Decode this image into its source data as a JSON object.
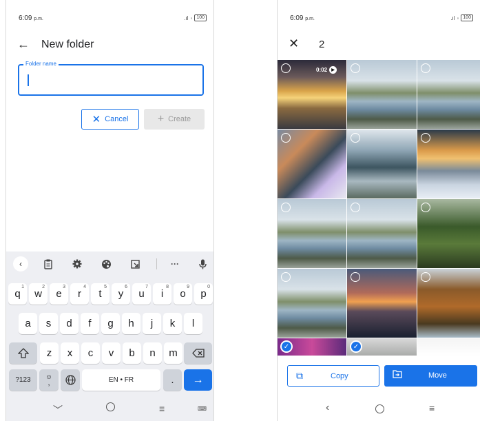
{
  "left_screen": {
    "status": {
      "time": "6:09",
      "time_suffix": "p.m.",
      "battery": "100"
    },
    "title": "New folder",
    "field_label": "Folder name",
    "field_value": "",
    "cancel_label": "Cancel",
    "create_label": "Create",
    "keyboard": {
      "toolbar": [
        "back-chevron-icon",
        "clipboard-icon",
        "settings-icon",
        "palette-icon",
        "resize-icon",
        "more-icon",
        "mic-icon"
      ],
      "more_label": "···",
      "row1": [
        {
          "key": "q",
          "hint": "1"
        },
        {
          "key": "w",
          "hint": "2"
        },
        {
          "key": "e",
          "hint": "3"
        },
        {
          "key": "r",
          "hint": "4"
        },
        {
          "key": "t",
          "hint": "5"
        },
        {
          "key": "y",
          "hint": "6"
        },
        {
          "key": "u",
          "hint": "7"
        },
        {
          "key": "i",
          "hint": "8"
        },
        {
          "key": "o",
          "hint": "9"
        },
        {
          "key": "p",
          "hint": "0"
        }
      ],
      "row2": [
        "a",
        "s",
        "d",
        "f",
        "g",
        "h",
        "j",
        "k",
        "l"
      ],
      "row3": [
        "z",
        "x",
        "c",
        "v",
        "b",
        "n",
        "m"
      ],
      "symbols_label": "?123",
      "emoji_comma": ",",
      "space_label": "EN • FR",
      "period_label": "."
    },
    "nav": [
      "chevron-down-icon",
      "home-circle-icon",
      "menu-icon",
      "keyboard-icon"
    ]
  },
  "right_screen": {
    "status": {
      "time": "6:09",
      "time_suffix": "p.m.",
      "battery": "100"
    },
    "selected_count": "2",
    "video_duration": "0:02",
    "tiles": [
      {
        "theme": "sunset-lake",
        "selected": false,
        "video": true
      },
      {
        "theme": "lake-rocks",
        "selected": false,
        "video": false
      },
      {
        "theme": "lake-rocks",
        "selected": false,
        "video": false
      },
      {
        "theme": "collage",
        "selected": false,
        "video": false
      },
      {
        "theme": "waterfall-lake",
        "selected": false,
        "video": false
      },
      {
        "theme": "winter-sunset",
        "selected": false,
        "video": false
      },
      {
        "theme": "lake-rocks",
        "selected": false,
        "video": false
      },
      {
        "theme": "lake-rocks",
        "selected": false,
        "video": false
      },
      {
        "theme": "green-valley",
        "selected": false,
        "video": false
      },
      {
        "theme": "lake-rocks",
        "selected": false,
        "video": false
      },
      {
        "theme": "sunset-sea",
        "selected": false,
        "video": false
      },
      {
        "theme": "autumn-forest",
        "selected": false,
        "video": false
      },
      {
        "theme": "purple-collage",
        "selected": true,
        "video": false
      },
      {
        "theme": "gray-strip",
        "selected": true,
        "video": false
      },
      {
        "theme": "blank",
        "selected": false,
        "video": false
      }
    ],
    "copy_label": "Copy",
    "move_label": "Move",
    "nav": [
      "back-icon",
      "home-icon",
      "recents-icon"
    ]
  },
  "colors": {
    "accent": "#1a73e8",
    "keyboard_bg": "#eeeff3",
    "disabled": "#e8e8e8"
  }
}
